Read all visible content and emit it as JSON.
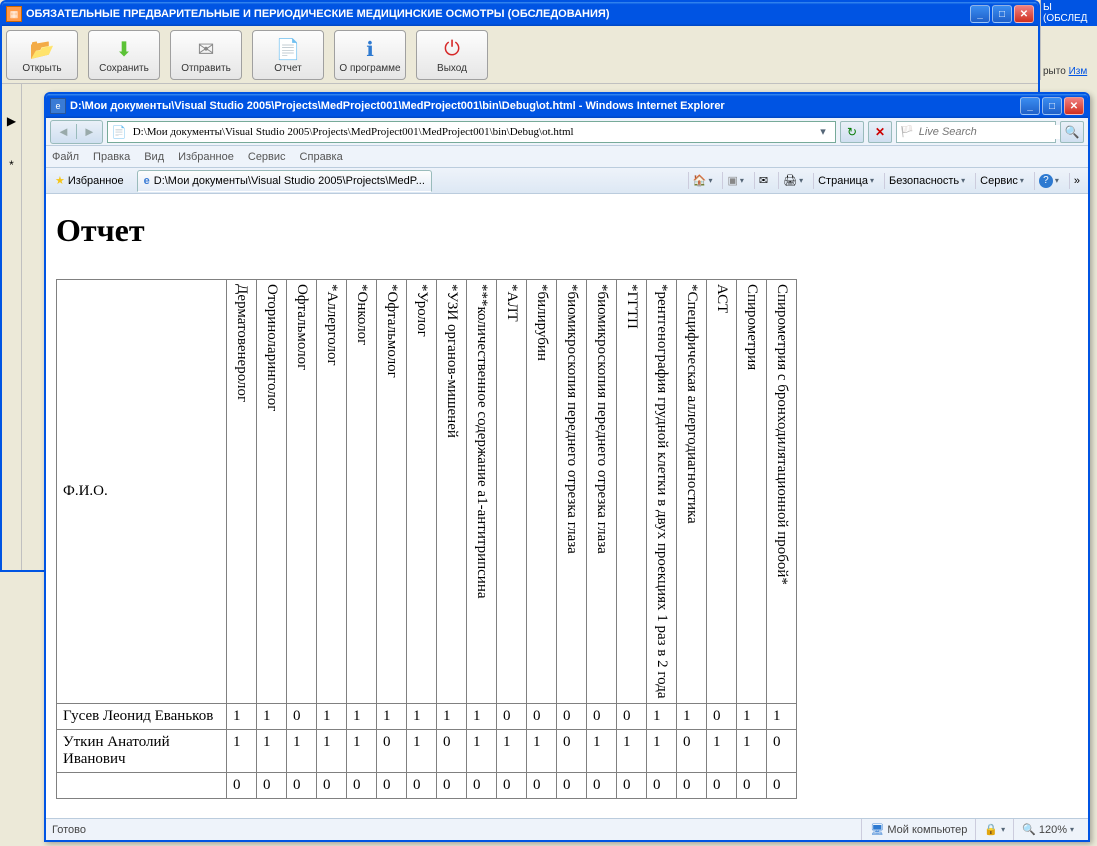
{
  "bg_fragment": {
    "title": "Ы (ОБСЛЕД",
    "line1": "рыто",
    "line2": "Изм"
  },
  "outer": {
    "title": "ОБЯЗАТЕЛЬНЫЕ ПРЕДВАРИТЕЛЬНЫЕ И ПЕРИОДИЧЕСКИЕ МЕДИЦИНСКИЕ ОСМОТРЫ (ОБСЛЕДОВАНИЯ)",
    "toolbar": [
      {
        "label": "Открыть",
        "icon": "📂",
        "color": "#3a7bd5"
      },
      {
        "label": "Сохранить",
        "icon": "⬇",
        "color": "#5bc236"
      },
      {
        "label": "Отправить",
        "icon": "✉",
        "color": "#888"
      },
      {
        "label": "Отчет",
        "icon": "📄",
        "color": "#2e7ad1"
      },
      {
        "label": "О программе",
        "icon": "ℹ",
        "color": "#2e7ad1"
      },
      {
        "label": "Выход",
        "icon": "⏻",
        "color": "#d62828"
      }
    ],
    "left_markers": [
      "▶",
      "*"
    ]
  },
  "ie": {
    "title": "D:\\Мои документы\\Visual Studio 2005\\Projects\\MedProject001\\MedProject001\\bin\\Debug\\ot.html - Windows Internet Explorer",
    "address": "D:\\Мои документы\\Visual Studio 2005\\Projects\\MedProject001\\MedProject001\\bin\\Debug\\ot.html",
    "search_placeholder": "Live Search",
    "menu": [
      "Файл",
      "Правка",
      "Вид",
      "Избранное",
      "Сервис",
      "Справка"
    ],
    "favorites_label": "Избранное",
    "tab_label": "D:\\Мои документы\\Visual Studio 2005\\Projects\\MedP...",
    "right_menu": {
      "page": "Страница",
      "security": "Безопасность",
      "service": "Сервис"
    },
    "status": {
      "left": "Готово",
      "zone": "Мой компьютер",
      "zoom": "120%"
    }
  },
  "report": {
    "heading": "Отчет",
    "fio_header": "Ф.И.О.",
    "columns": [
      "Дерматовенеролог",
      "Оториноларинголог",
      "Офтальмолог",
      "*Аллерголог",
      "*Онколог",
      "*Офтальмолог",
      "*Уролог",
      "*УЗИ органов-мишеней",
      "***количественное содержание a1-антитрипсина",
      "*АЛТ",
      "*билирубин",
      "*биомикроскопия переднего отрезка глаза",
      "*биомикроскопия переднего отрезка глаза",
      "*ГГТП",
      "*рентгенография грудной клетки в двух проекциях 1 раз в 2 года",
      "*Специфическая аллергодиагностика",
      "АСТ",
      "Спирометрия",
      "Спирометрия с бронходилятационной пробой*"
    ],
    "rows": [
      {
        "name": "Гусев Леонид Еваньков",
        "vals": [
          1,
          1,
          0,
          1,
          1,
          1,
          1,
          1,
          1,
          0,
          0,
          0,
          0,
          0,
          1,
          1,
          0,
          1,
          1
        ]
      },
      {
        "name": "Уткин Анатолий Иванович",
        "vals": [
          1,
          1,
          1,
          1,
          1,
          0,
          1,
          0,
          1,
          1,
          1,
          0,
          1,
          1,
          1,
          0,
          1,
          1,
          0
        ]
      },
      {
        "name": "",
        "vals": [
          0,
          0,
          0,
          0,
          0,
          0,
          0,
          0,
          0,
          0,
          0,
          0,
          0,
          0,
          0,
          0,
          0,
          0,
          0
        ]
      }
    ]
  }
}
